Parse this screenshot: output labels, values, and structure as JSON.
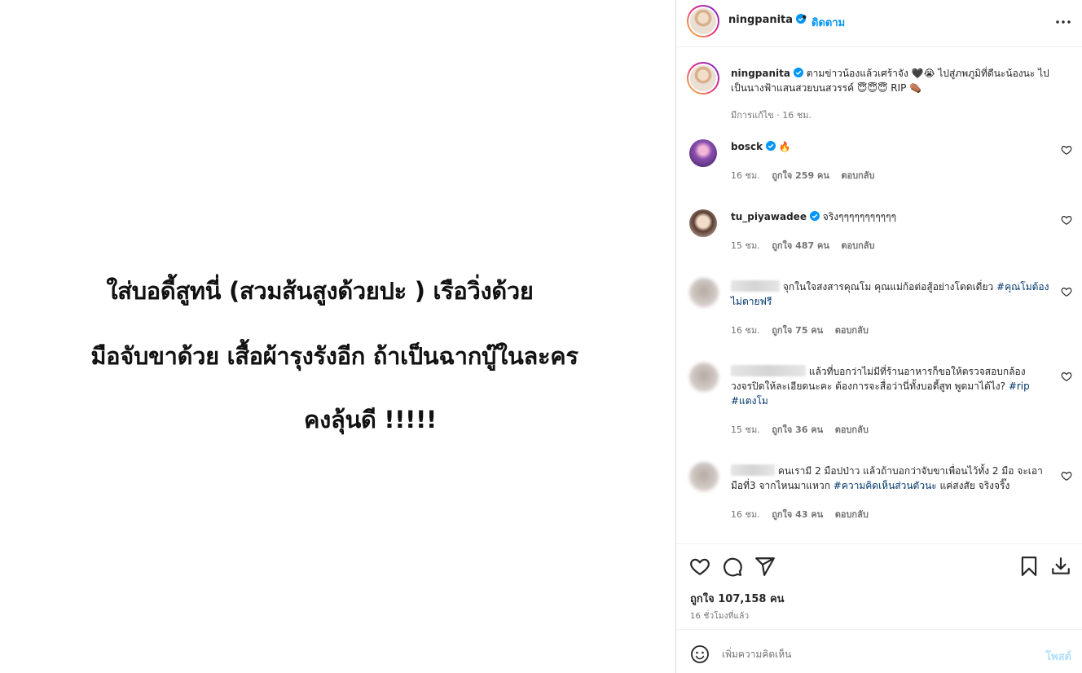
{
  "image_text": {
    "line1": "ใส่บอดี้สูทนี่ (สวมส้นสูงด้วยปะ ) เรือวิ่งด้วย",
    "line2": "มือจับขาด้วย เสื้อผ้ารุงรังอีก ถ้าเป็นฉากบู๊ในละคร",
    "line3": "คงลุ้นดี !!!!!"
  },
  "header": {
    "username": "ningpanita",
    "dot": "•",
    "follow_label": "ติดตาม"
  },
  "caption": {
    "username": "ningpanita",
    "text": "ตามข่าวน้องแล้วเศร้าจัง 🖤😭 ไปสู่ภพภูมิที่ดีนะน้องนะ ไปเป็นนางฟ้าแสนสวยบนสวรรค์ 😇😇😇 RIP ⚰️",
    "meta": "มีการแก้ไข · 16 ชม."
  },
  "comments": [
    {
      "username": "bosck",
      "text": "🔥",
      "time": "16 ชม.",
      "likes": "ถูกใจ 259 คน",
      "reply": "ตอบกลับ"
    },
    {
      "username": "tu_piyawadee",
      "text": "จริงๆๆๆๆๆๆๆๆๆๆๆ",
      "time": "15 ชม.",
      "likes": "ถูกใจ 487 คน",
      "reply": "ตอบกลับ"
    },
    {
      "text_pre": "จุกในใจสงสารคุณโม คุณแม่ก้อต่อสู้อย่างโดดเดี่ยว ",
      "hashtag": "#คุณโมต้องไม่ตายฟรี",
      "time": "16 ชม.",
      "likes": "ถูกใจ 75 คน",
      "reply": "ตอบกลับ"
    },
    {
      "text_pre": "แล้วที่บอกว่าไม่มีที่ร้านอาหารก็ขอให้ตรวจสอบกล้องวงจรปิดให้ละเอียดนะคะ ต้องการจะสื่อว่านี่ทั้งบอดี้สูท พูดมาได้ไง? ",
      "hashtag": "#rip",
      "hashtag2": "#แตงโม",
      "time": "15 ชม.",
      "likes": "ถูกใจ 36 คน",
      "reply": "ตอบกลับ"
    },
    {
      "text_pre": "คนเรามี 2 มือปป่าว แล้วถ้าบอกว่าจับขาเพื่อนไว้ทั้ง 2 มือ จะเอามือที่3 จากไหนมาแหวก ",
      "hashtag": "#ความคิดเห็นส่วนตัวนะ",
      "text_post": " แค่สงสัย จริงจริ๊ง",
      "time": "16 ชม.",
      "likes": "ถูกใจ 43 คน",
      "reply": "ตอบกลับ"
    }
  ],
  "actions": {
    "likes": "ถูกใจ 107,158 คน",
    "time_ago": "16 ชั่วโมงที่แล้ว"
  },
  "comment_bar": {
    "placeholder": "เพิ่มความคิดเห็น",
    "post_label": "โพสต์"
  },
  "colors": {
    "accent": "#0095f6",
    "hashtag": "#00376b",
    "muted": "#737373",
    "verified": "#0095f6"
  },
  "icons": [
    "verified-icon",
    "more-icon",
    "heart-icon",
    "comment-icon",
    "share-icon",
    "bookmark-icon",
    "download-icon",
    "emoji-icon"
  ]
}
